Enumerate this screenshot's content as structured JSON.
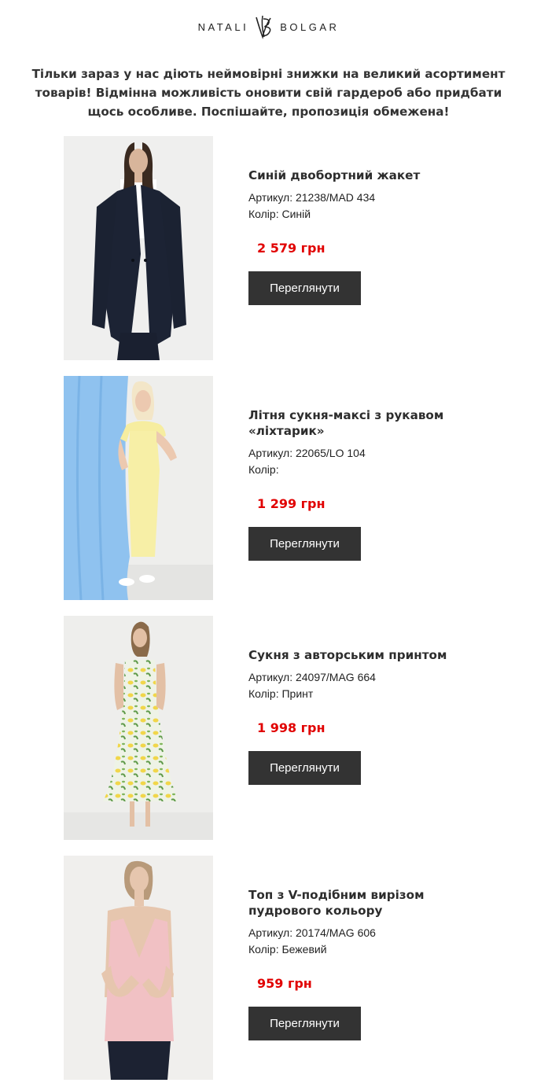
{
  "brand": {
    "left_word": "NATALI",
    "right_word": "BOLGAR"
  },
  "intro_text": "Тільки зараз у нас діють неймовірні знижки на великий асортимент товарів! Відмінна можливість оновити свій гардероб або придбати щось особливе. Поспішайте, пропозиція обмежена!",
  "labels": {
    "article": "Артикул:",
    "color": "Колір:"
  },
  "products": [
    {
      "title": "Синій двобортний жакет",
      "article": "21238/MAD 434",
      "color": "Синій",
      "price": "2 579 грн",
      "button_label": "Переглянути",
      "image_alt": "Синій двобортний жакет"
    },
    {
      "title": "Літня сукня-максі з рукавом «ліхтарик»",
      "article": "22065/LO 104",
      "color": "",
      "price": "1 299 грн",
      "button_label": "Переглянути",
      "image_alt": "Літня сукня-максі з рукавом «ліхтарик»"
    },
    {
      "title": "Сукня з авторським принтом",
      "article": "24097/MAG 664",
      "color": "Принт",
      "price": "1 998 грн",
      "button_label": "Переглянути",
      "image_alt": "Сукня з авторським принтом"
    },
    {
      "title": "Топ з V-подібним вирізом пудрового кольору",
      "article": "20174/MAG 606",
      "color": "Бежевий",
      "price": "959 грн",
      "button_label": "Переглянути",
      "image_alt": "Топ з V-подібним вирізом пудрового кольору"
    }
  ],
  "colors": {
    "price": "#e10000",
    "button_bg": "#333333",
    "button_text": "#ffffff",
    "heading_text": "#333333"
  }
}
